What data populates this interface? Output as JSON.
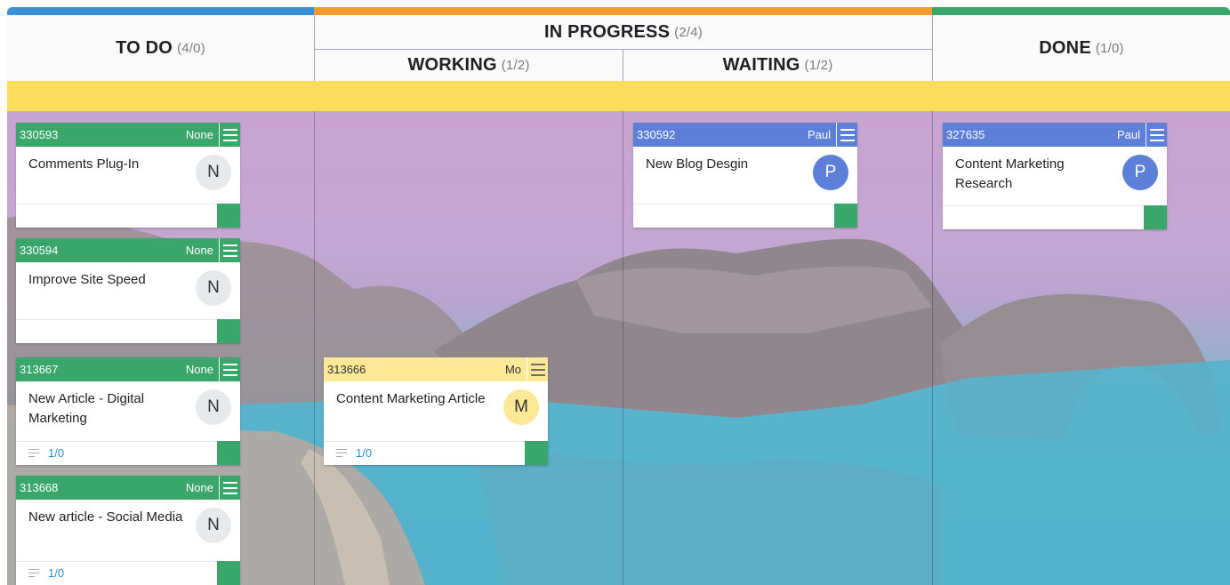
{
  "colors": {
    "green": "#3aa66a",
    "blue": "#5d7fd7",
    "yellow": "#fde896",
    "stripe_todo": "#3a8fd6",
    "stripe_progress": "#f29a2e",
    "stripe_done": "#3aa66a"
  },
  "columns": {
    "todo": {
      "title": "TO DO",
      "count": "(4/0)"
    },
    "in_progress": {
      "title": "IN PROGRESS",
      "count": "(2/4)"
    },
    "working": {
      "title": "WORKING",
      "count": "(1/2)"
    },
    "waiting": {
      "title": "WAITING",
      "count": "(1/2)"
    },
    "done": {
      "title": "DONE",
      "count": "(1/0)"
    }
  },
  "cards": {
    "c330593": {
      "id": "330593",
      "owner": "None",
      "title": "Comments Plug-In",
      "avatar": "N"
    },
    "c330594": {
      "id": "330594",
      "owner": "None",
      "title": "Improve Site Speed",
      "avatar": "N"
    },
    "c313667": {
      "id": "313667",
      "owner": "None",
      "title": "New Article - Digital Marketing",
      "avatar": "N",
      "checklist": "1/0"
    },
    "c313668": {
      "id": "313668",
      "owner": "None",
      "title": "New article - Social Media",
      "avatar": "N",
      "checklist": "1/0"
    },
    "c313666": {
      "id": "313666",
      "owner": "Mo",
      "title": "Content Marketing Article",
      "avatar": "M",
      "checklist": "1/0"
    },
    "c330592": {
      "id": "330592",
      "owner": "Paul",
      "title": "New Blog Desgin",
      "avatar": "P"
    },
    "c327635": {
      "id": "327635",
      "owner": "Paul",
      "title": "Content Marketing Research",
      "avatar": "P"
    }
  }
}
